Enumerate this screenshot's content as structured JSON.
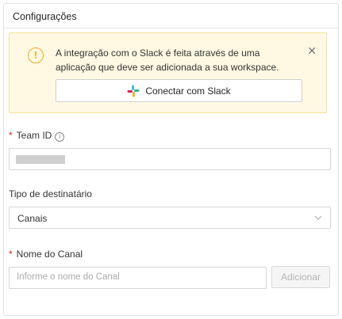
{
  "card": {
    "title": "Configurações"
  },
  "alert": {
    "icon": "exclamation-circle-icon",
    "message": "A integração com o Slack é feita através de uma aplicação que deve ser adicionada a sua workspace.",
    "close_icon": "close-icon",
    "connect_button_label": "Conectar com Slack",
    "connect_button_icon": "slack-logo-icon"
  },
  "team_id": {
    "required_mark": "*",
    "label": "Team ID",
    "info_icon": "info-icon"
  },
  "recipient_type": {
    "label": "Tipo de destinatário",
    "selected": "Canais"
  },
  "channel_name": {
    "required_mark": "*",
    "label": "Nome do Canal",
    "placeholder": "Informe o nome do Canal",
    "add_button_label": "Adicionar"
  },
  "colors": {
    "alert_bg": "#fff9e3",
    "alert_border": "#f6df98",
    "warning": "#f0ad1a",
    "required": "#e02020"
  }
}
